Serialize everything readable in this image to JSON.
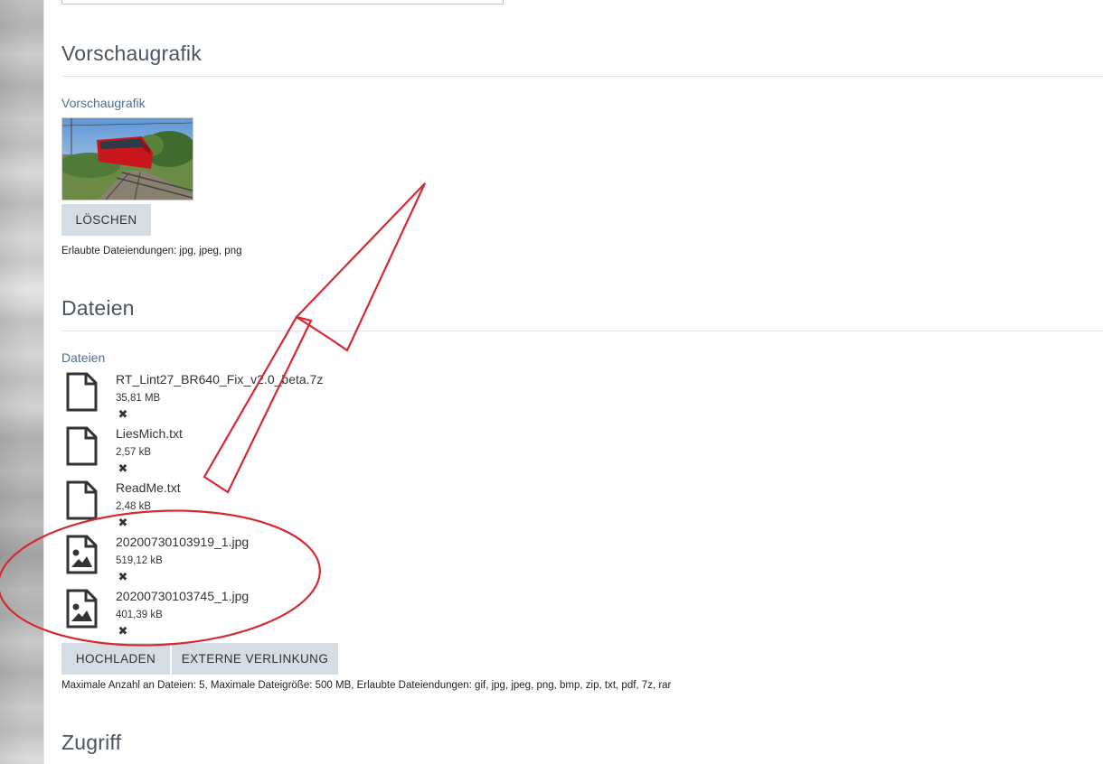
{
  "preview": {
    "heading": "Vorschaugrafik",
    "label": "Vorschaugrafik",
    "delete_label": "LÖSCHEN",
    "allowed": "Erlaubte Dateiendungen: jpg, jpeg, png"
  },
  "files": {
    "heading": "Dateien",
    "label": "Dateien",
    "items": [
      {
        "name": "RT_Lint27_BR640_Fix_v2.0_beta.7z",
        "size": "35,81 MB",
        "icon": "file-icon"
      },
      {
        "name": "LiesMich.txt",
        "size": "2,57 kB",
        "icon": "file-icon"
      },
      {
        "name": "ReadMe.txt",
        "size": "2,48 kB",
        "icon": "file-icon"
      },
      {
        "name": "20200730103919_1.jpg",
        "size": "519,12 kB",
        "icon": "image-file-icon"
      },
      {
        "name": "20200730103745_1.jpg",
        "size": "401,39 kB",
        "icon": "image-file-icon"
      }
    ],
    "remove_glyph": "✖",
    "upload_label": "HOCHLADEN",
    "external_label": "EXTERNE VERLINKUNG",
    "limits": "Maximale Anzahl an Dateien: 5, Maximale Dateigröße: 500 MB, Erlaubte Dateiendungen: gif, jpg, jpeg, png, bmp, zip, txt, pdf, 7z, rar"
  },
  "access": {
    "heading": "Zugriff"
  },
  "annotation_color": "#d42a33"
}
